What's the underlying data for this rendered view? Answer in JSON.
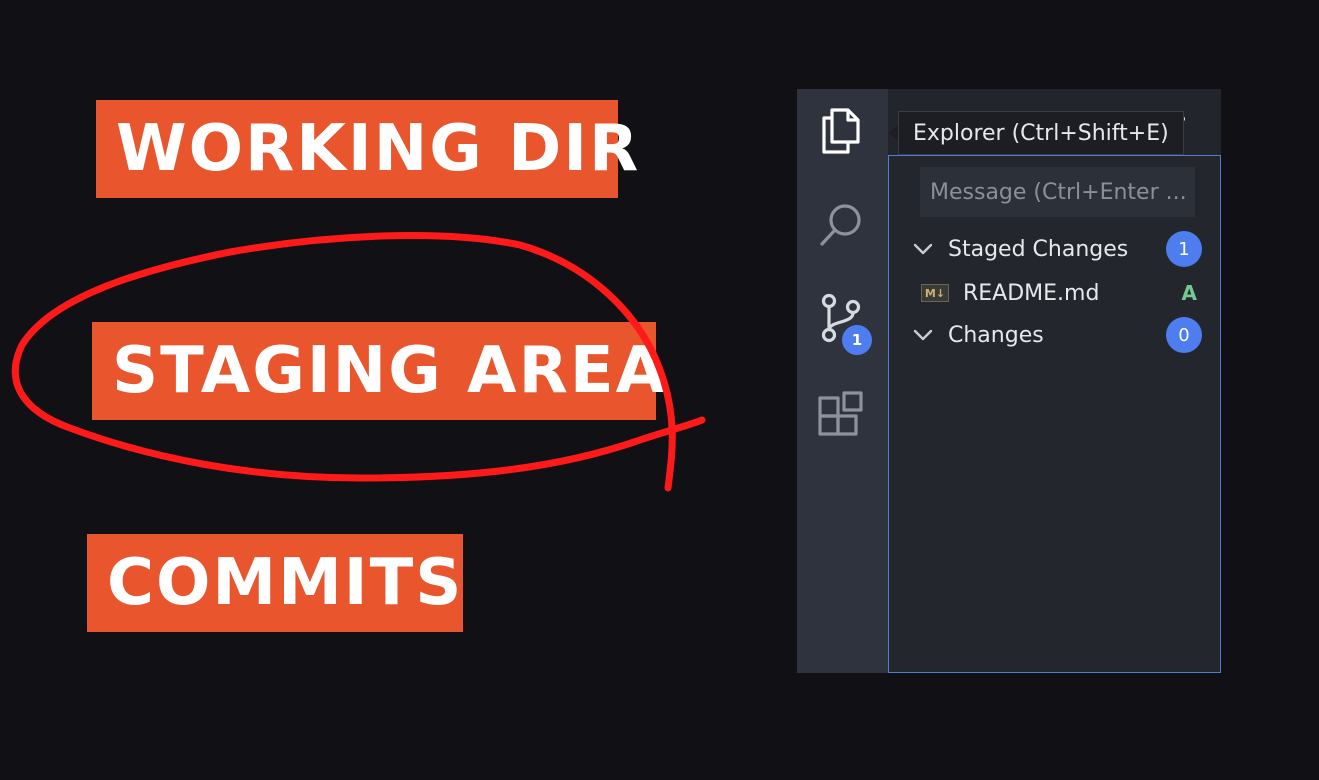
{
  "labels": {
    "working_dir": "WORKING DIR",
    "staging_area": "STAGING AREA",
    "commits": "COMMITS"
  },
  "colors": {
    "background": "#111015",
    "label_bg": "#e9552d",
    "scribble": "#ff1a1a",
    "badge": "#4e7df0",
    "added_status": "#73c991"
  },
  "vscode": {
    "activity_bar": {
      "items": [
        {
          "name": "explorer",
          "icon": "files-icon"
        },
        {
          "name": "search",
          "icon": "search-icon"
        },
        {
          "name": "source-control",
          "icon": "source-control-icon",
          "badge": "1"
        },
        {
          "name": "extensions",
          "icon": "extensions-icon"
        }
      ]
    },
    "tooltip": "Explorer (Ctrl+Shift+E)",
    "more_actions": "···",
    "scm": {
      "message_placeholder": "Message (Ctrl+Enter ...",
      "staged": {
        "label": "Staged Changes",
        "count": "1",
        "files": [
          {
            "icon": "M↓",
            "name": "README.md",
            "status": "A"
          }
        ]
      },
      "changes": {
        "label": "Changes",
        "count": "0"
      }
    }
  }
}
